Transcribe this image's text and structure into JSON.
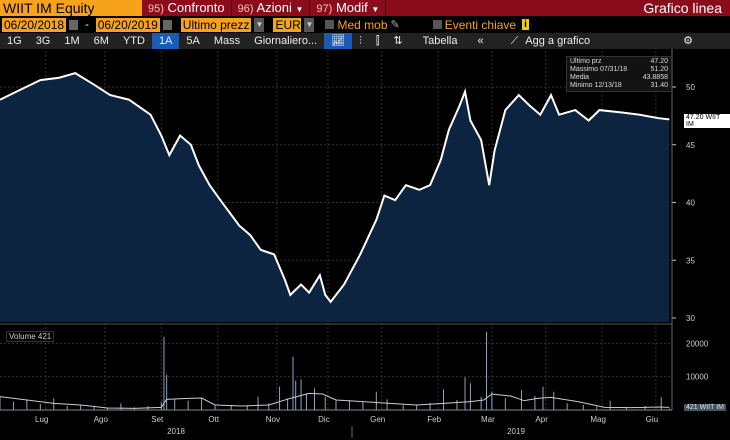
{
  "header": {
    "ticker": "WIIT IM Equity",
    "menu": [
      {
        "num": "95)",
        "label": "Confronto"
      },
      {
        "num": "96)",
        "label": "Azioni"
      },
      {
        "num": "97)",
        "label": "Modif"
      }
    ],
    "chart_type": "Grafico linea"
  },
  "controls": {
    "start_date": "06/20/2018",
    "end_date": "06/20/2019",
    "field": "Ultimo prezz",
    "currency": "EUR",
    "med_mob": "Med mob",
    "eventi": "Eventi chiave",
    "info": "i",
    "sep": "-"
  },
  "toolbar": {
    "periods": [
      "1G",
      "3G",
      "1M",
      "6M",
      "YTD",
      "1A",
      "5A",
      "Mass"
    ],
    "active": "1A",
    "frequency": "Giornaliero...",
    "table": "Tabella",
    "collapse": "«",
    "add": "Agg a grafico"
  },
  "legend": [
    {
      "label": "Ultimo prz",
      "value": "47.20"
    },
    {
      "label": "Massimo 07/31/18",
      "value": "51.20"
    },
    {
      "label": "Media",
      "value": "43.8858"
    },
    {
      "label": "Minimo 12/13/18",
      "value": "31.40"
    }
  ],
  "price_tag": "47.20 WIIT IM",
  "volume_label": "Volume 421",
  "volume_tag": "421 WIIT IM",
  "colors": {
    "area": "#0c2440",
    "line": "#ffffff",
    "accent": "#f7a21b",
    "brand": "#8b0d1c"
  },
  "chart_data": [
    {
      "type": "area",
      "title": "WIIT IM Equity",
      "yticks": [
        30,
        35,
        40,
        45,
        50
      ],
      "ylim": [
        29.5,
        53
      ],
      "xlim": [
        0,
        250
      ],
      "x_labels": [
        "Lug",
        "Ago",
        "Set",
        "Ott",
        "Nov",
        "Dic",
        "Gen",
        "Feb",
        "Mar",
        "Apr",
        "Mag",
        "Giu"
      ],
      "x_label_days": [
        17,
        39,
        60,
        81,
        103,
        122,
        142,
        163,
        183,
        203,
        224,
        244
      ],
      "years": [
        "2018",
        "2019"
      ],
      "points": [
        [
          0,
          48.9
        ],
        [
          7,
          49.7
        ],
        [
          15,
          50.6
        ],
        [
          22,
          50.8
        ],
        [
          28,
          51.2
        ],
        [
          35,
          50.2
        ],
        [
          41,
          49.3
        ],
        [
          48,
          48.9
        ],
        [
          56,
          47.6
        ],
        [
          60,
          45.8
        ],
        [
          63,
          44.1
        ],
        [
          67,
          45.8
        ],
        [
          71,
          45.0
        ],
        [
          74,
          43.2
        ],
        [
          78,
          41.5
        ],
        [
          82,
          40.2
        ],
        [
          89,
          38.0
        ],
        [
          93,
          37.2
        ],
        [
          97,
          35.9
        ],
        [
          102,
          35.5
        ],
        [
          106,
          33.3
        ],
        [
          108,
          32.0
        ],
        [
          112,
          32.9
        ],
        [
          115,
          32.2
        ],
        [
          119,
          33.7
        ],
        [
          121,
          32.0
        ],
        [
          123,
          31.4
        ],
        [
          128,
          32.9
        ],
        [
          134,
          35.5
        ],
        [
          140,
          38.5
        ],
        [
          143,
          40.6
        ],
        [
          147,
          40.2
        ],
        [
          151,
          41.5
        ],
        [
          156,
          41.1
        ],
        [
          160,
          41.5
        ],
        [
          164,
          43.7
        ],
        [
          167,
          46.3
        ],
        [
          171,
          48.4
        ],
        [
          173,
          49.6
        ],
        [
          175,
          47.1
        ],
        [
          179,
          45.4
        ],
        [
          182,
          41.5
        ],
        [
          184,
          44.5
        ],
        [
          188,
          48.0
        ],
        [
          193,
          49.3
        ],
        [
          197,
          48.4
        ],
        [
          201,
          47.6
        ],
        [
          205,
          49.3
        ],
        [
          208,
          47.6
        ],
        [
          214,
          48.0
        ],
        [
          219,
          47.1
        ],
        [
          223,
          48.0
        ],
        [
          231,
          47.8
        ],
        [
          238,
          47.6
        ],
        [
          245,
          47.3
        ],
        [
          249,
          47.2
        ]
      ]
    },
    {
      "type": "bar",
      "title": "Volume",
      "yticks": [
        10000,
        20000
      ],
      "ylim": [
        0,
        27000
      ],
      "volume": [
        [
          0,
          4000
        ],
        [
          5,
          2500
        ],
        [
          10,
          3000
        ],
        [
          15,
          1800
        ],
        [
          20,
          3500
        ],
        [
          25,
          1200
        ],
        [
          30,
          1500
        ],
        [
          35,
          1000
        ],
        [
          40,
          600
        ],
        [
          45,
          2000
        ],
        [
          50,
          800
        ],
        [
          55,
          1200
        ],
        [
          60,
          2500
        ],
        [
          61,
          22000
        ],
        [
          62,
          10500
        ],
        [
          65,
          3200
        ],
        [
          70,
          2800
        ],
        [
          75,
          3500
        ],
        [
          80,
          1500
        ],
        [
          86,
          1500
        ],
        [
          92,
          1200
        ],
        [
          96,
          4000
        ],
        [
          100,
          2000
        ],
        [
          104,
          7000
        ],
        [
          107,
          3500
        ],
        [
          109,
          16000
        ],
        [
          110,
          8800
        ],
        [
          112,
          9200
        ],
        [
          114,
          5000
        ],
        [
          117,
          6500
        ],
        [
          121,
          4000
        ],
        [
          125,
          2800
        ],
        [
          130,
          3000
        ],
        [
          135,
          2500
        ],
        [
          140,
          5500
        ],
        [
          144,
          3200
        ],
        [
          150,
          1500
        ],
        [
          155,
          1400
        ],
        [
          160,
          2200
        ],
        [
          165,
          6200
        ],
        [
          170,
          3000
        ],
        [
          173,
          9800
        ],
        [
          175,
          8000
        ],
        [
          179,
          4000
        ],
        [
          181,
          23500
        ],
        [
          183,
          5500
        ],
        [
          188,
          3500
        ],
        [
          194,
          6000
        ],
        [
          199,
          4200
        ],
        [
          202,
          7000
        ],
        [
          206,
          5500
        ],
        [
          211,
          2000
        ],
        [
          217,
          1500
        ],
        [
          222,
          1000
        ],
        [
          227,
          2800
        ],
        [
          233,
          1000
        ],
        [
          240,
          1200
        ],
        [
          246,
          3800
        ],
        [
          249,
          421
        ]
      ],
      "avg": [
        [
          0,
          4000
        ],
        [
          10,
          3000
        ],
        [
          20,
          2000
        ],
        [
          30,
          1500
        ],
        [
          40,
          600
        ],
        [
          50,
          500
        ],
        [
          60,
          800
        ],
        [
          62,
          3200
        ],
        [
          70,
          3500
        ],
        [
          75,
          3600
        ],
        [
          80,
          1500
        ],
        [
          90,
          1200
        ],
        [
          100,
          1500
        ],
        [
          108,
          3500
        ],
        [
          115,
          5000
        ],
        [
          120,
          4800
        ],
        [
          125,
          3000
        ],
        [
          135,
          2500
        ],
        [
          145,
          2000
        ],
        [
          155,
          1500
        ],
        [
          165,
          2000
        ],
        [
          175,
          2500
        ],
        [
          180,
          3000
        ],
        [
          183,
          4800
        ],
        [
          190,
          4200
        ],
        [
          195,
          2800
        ],
        [
          200,
          3500
        ],
        [
          205,
          3800
        ],
        [
          215,
          2500
        ],
        [
          225,
          800
        ],
        [
          235,
          700
        ],
        [
          245,
          900
        ],
        [
          249,
          800
        ]
      ]
    }
  ]
}
